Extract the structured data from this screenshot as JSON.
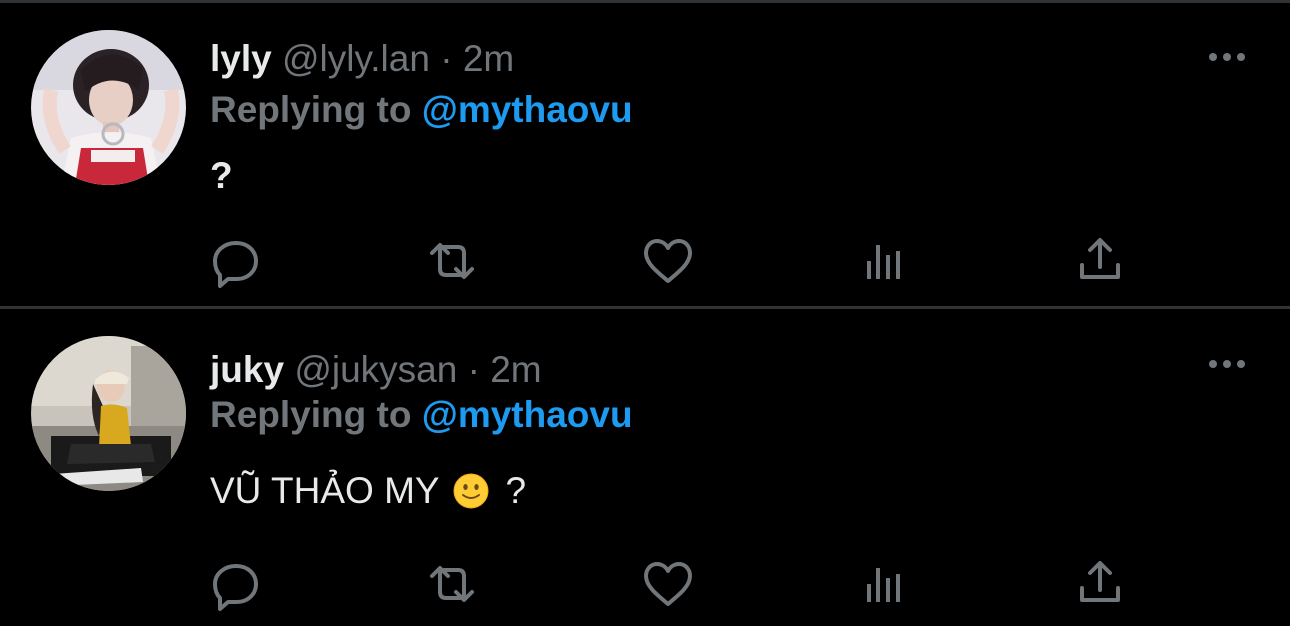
{
  "tweets": [
    {
      "name": "lyly",
      "handle": "@lyly.lan",
      "separator": "·",
      "time": "2m",
      "replying_label": "Replying to",
      "replying_to": "@mythaovu",
      "text": "?",
      "text_suffix": "",
      "emoji": null
    },
    {
      "name": "juky",
      "handle": "@jukysan",
      "separator": "·",
      "time": "2m",
      "replying_label": "Replying to",
      "replying_to": "@mythaovu",
      "text": "VŨ THẢO MY",
      "text_suffix": "?",
      "emoji": "slightly-smiling-face"
    }
  ],
  "action_icons": [
    "reply-icon",
    "retweet-icon",
    "like-icon",
    "views-icon",
    "share-icon"
  ],
  "colors": {
    "background": "#000000",
    "divider": "#2f3336",
    "primary_text": "#e7e9ea",
    "secondary_text": "#71767b",
    "link": "#1d9bf0"
  }
}
